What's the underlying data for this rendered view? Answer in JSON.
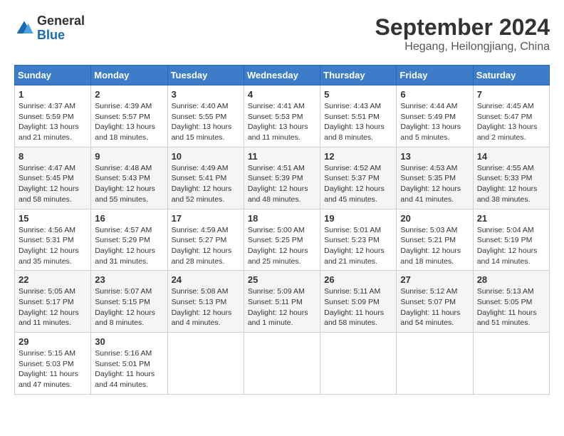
{
  "logo": {
    "general": "General",
    "blue": "Blue"
  },
  "title": "September 2024",
  "subtitle": "Hegang, Heilongjiang, China",
  "weekdays": [
    "Sunday",
    "Monday",
    "Tuesday",
    "Wednesday",
    "Thursday",
    "Friday",
    "Saturday"
  ],
  "weeks": [
    [
      {
        "day": "1",
        "sunrise": "Sunrise: 4:37 AM",
        "sunset": "Sunset: 5:59 PM",
        "daylight": "Daylight: 13 hours and 21 minutes."
      },
      {
        "day": "2",
        "sunrise": "Sunrise: 4:39 AM",
        "sunset": "Sunset: 5:57 PM",
        "daylight": "Daylight: 13 hours and 18 minutes."
      },
      {
        "day": "3",
        "sunrise": "Sunrise: 4:40 AM",
        "sunset": "Sunset: 5:55 PM",
        "daylight": "Daylight: 13 hours and 15 minutes."
      },
      {
        "day": "4",
        "sunrise": "Sunrise: 4:41 AM",
        "sunset": "Sunset: 5:53 PM",
        "daylight": "Daylight: 13 hours and 11 minutes."
      },
      {
        "day": "5",
        "sunrise": "Sunrise: 4:43 AM",
        "sunset": "Sunset: 5:51 PM",
        "daylight": "Daylight: 13 hours and 8 minutes."
      },
      {
        "day": "6",
        "sunrise": "Sunrise: 4:44 AM",
        "sunset": "Sunset: 5:49 PM",
        "daylight": "Daylight: 13 hours and 5 minutes."
      },
      {
        "day": "7",
        "sunrise": "Sunrise: 4:45 AM",
        "sunset": "Sunset: 5:47 PM",
        "daylight": "Daylight: 13 hours and 2 minutes."
      }
    ],
    [
      {
        "day": "8",
        "sunrise": "Sunrise: 4:47 AM",
        "sunset": "Sunset: 5:45 PM",
        "daylight": "Daylight: 12 hours and 58 minutes."
      },
      {
        "day": "9",
        "sunrise": "Sunrise: 4:48 AM",
        "sunset": "Sunset: 5:43 PM",
        "daylight": "Daylight: 12 hours and 55 minutes."
      },
      {
        "day": "10",
        "sunrise": "Sunrise: 4:49 AM",
        "sunset": "Sunset: 5:41 PM",
        "daylight": "Daylight: 12 hours and 52 minutes."
      },
      {
        "day": "11",
        "sunrise": "Sunrise: 4:51 AM",
        "sunset": "Sunset: 5:39 PM",
        "daylight": "Daylight: 12 hours and 48 minutes."
      },
      {
        "day": "12",
        "sunrise": "Sunrise: 4:52 AM",
        "sunset": "Sunset: 5:37 PM",
        "daylight": "Daylight: 12 hours and 45 minutes."
      },
      {
        "day": "13",
        "sunrise": "Sunrise: 4:53 AM",
        "sunset": "Sunset: 5:35 PM",
        "daylight": "Daylight: 12 hours and 41 minutes."
      },
      {
        "day": "14",
        "sunrise": "Sunrise: 4:55 AM",
        "sunset": "Sunset: 5:33 PM",
        "daylight": "Daylight: 12 hours and 38 minutes."
      }
    ],
    [
      {
        "day": "15",
        "sunrise": "Sunrise: 4:56 AM",
        "sunset": "Sunset: 5:31 PM",
        "daylight": "Daylight: 12 hours and 35 minutes."
      },
      {
        "day": "16",
        "sunrise": "Sunrise: 4:57 AM",
        "sunset": "Sunset: 5:29 PM",
        "daylight": "Daylight: 12 hours and 31 minutes."
      },
      {
        "day": "17",
        "sunrise": "Sunrise: 4:59 AM",
        "sunset": "Sunset: 5:27 PM",
        "daylight": "Daylight: 12 hours and 28 minutes."
      },
      {
        "day": "18",
        "sunrise": "Sunrise: 5:00 AM",
        "sunset": "Sunset: 5:25 PM",
        "daylight": "Daylight: 12 hours and 25 minutes."
      },
      {
        "day": "19",
        "sunrise": "Sunrise: 5:01 AM",
        "sunset": "Sunset: 5:23 PM",
        "daylight": "Daylight: 12 hours and 21 minutes."
      },
      {
        "day": "20",
        "sunrise": "Sunrise: 5:03 AM",
        "sunset": "Sunset: 5:21 PM",
        "daylight": "Daylight: 12 hours and 18 minutes."
      },
      {
        "day": "21",
        "sunrise": "Sunrise: 5:04 AM",
        "sunset": "Sunset: 5:19 PM",
        "daylight": "Daylight: 12 hours and 14 minutes."
      }
    ],
    [
      {
        "day": "22",
        "sunrise": "Sunrise: 5:05 AM",
        "sunset": "Sunset: 5:17 PM",
        "daylight": "Daylight: 12 hours and 11 minutes."
      },
      {
        "day": "23",
        "sunrise": "Sunrise: 5:07 AM",
        "sunset": "Sunset: 5:15 PM",
        "daylight": "Daylight: 12 hours and 8 minutes."
      },
      {
        "day": "24",
        "sunrise": "Sunrise: 5:08 AM",
        "sunset": "Sunset: 5:13 PM",
        "daylight": "Daylight: 12 hours and 4 minutes."
      },
      {
        "day": "25",
        "sunrise": "Sunrise: 5:09 AM",
        "sunset": "Sunset: 5:11 PM",
        "daylight": "Daylight: 12 hours and 1 minute."
      },
      {
        "day": "26",
        "sunrise": "Sunrise: 5:11 AM",
        "sunset": "Sunset: 5:09 PM",
        "daylight": "Daylight: 11 hours and 58 minutes."
      },
      {
        "day": "27",
        "sunrise": "Sunrise: 5:12 AM",
        "sunset": "Sunset: 5:07 PM",
        "daylight": "Daylight: 11 hours and 54 minutes."
      },
      {
        "day": "28",
        "sunrise": "Sunrise: 5:13 AM",
        "sunset": "Sunset: 5:05 PM",
        "daylight": "Daylight: 11 hours and 51 minutes."
      }
    ],
    [
      {
        "day": "29",
        "sunrise": "Sunrise: 5:15 AM",
        "sunset": "Sunset: 5:03 PM",
        "daylight": "Daylight: 11 hours and 47 minutes."
      },
      {
        "day": "30",
        "sunrise": "Sunrise: 5:16 AM",
        "sunset": "Sunset: 5:01 PM",
        "daylight": "Daylight: 11 hours and 44 minutes."
      },
      null,
      null,
      null,
      null,
      null
    ]
  ]
}
